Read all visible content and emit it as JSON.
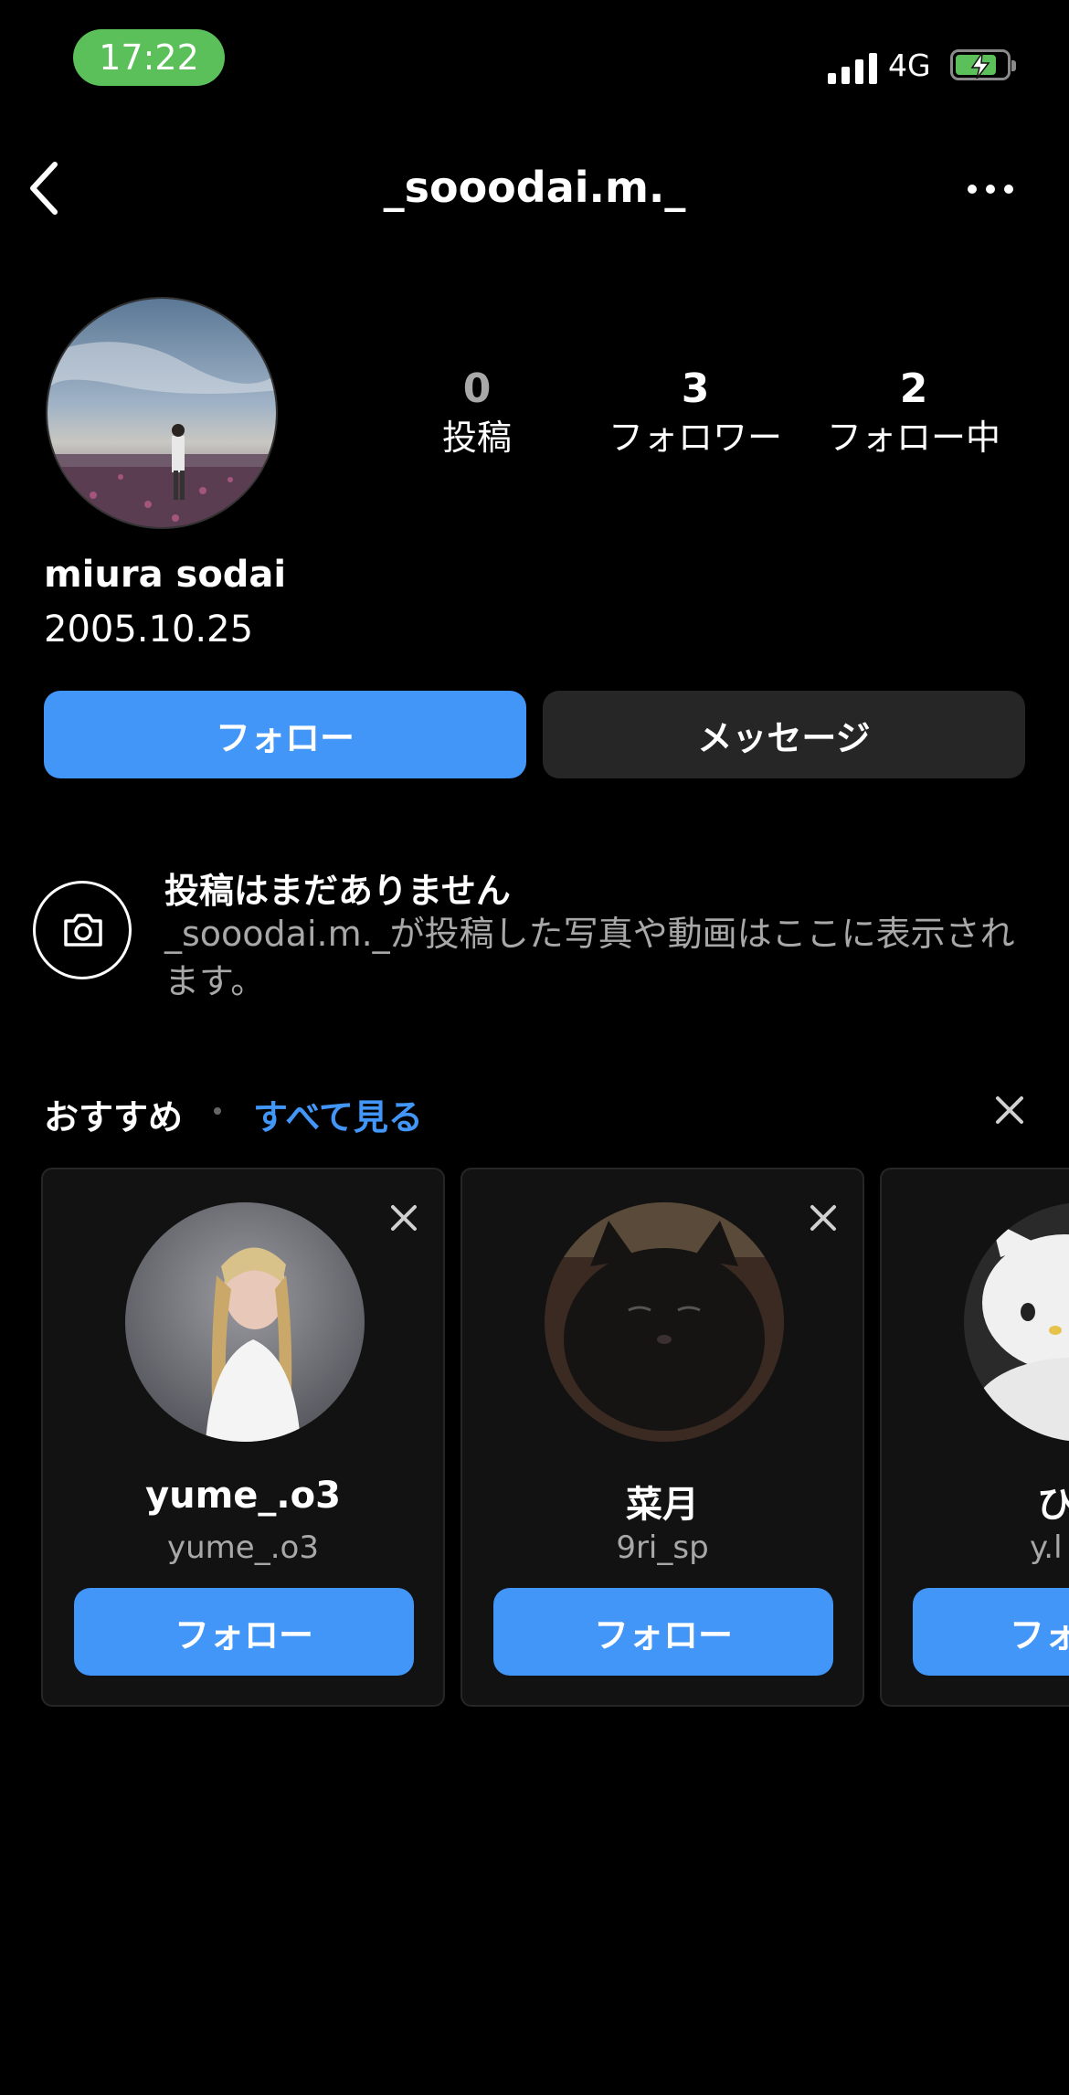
{
  "status_bar": {
    "time": "17:22",
    "network": "4G"
  },
  "header": {
    "username": "_sooodai.m._"
  },
  "profile": {
    "stats": [
      {
        "value": "0",
        "label": "投稿"
      },
      {
        "value": "3",
        "label": "フォロワー"
      },
      {
        "value": "2",
        "label": "フォロー中"
      }
    ],
    "name": "miura sodai",
    "bio": "2005.10.25"
  },
  "actions": {
    "follow": "フォロー",
    "message": "メッセージ"
  },
  "empty_state": {
    "title": "投稿はまだありません",
    "description": "_sooodai.m._が投稿した写真や動画はここに表示されます。"
  },
  "suggestions": {
    "label": "おすすめ",
    "see_all": "すべて見る",
    "cards": [
      {
        "name": "yume_.o3",
        "username": "yume_.o3",
        "button": "フォロー"
      },
      {
        "name": "菜月",
        "username": "9ri_sp",
        "button": "フォロー"
      },
      {
        "name": "ひ",
        "username": "y.l",
        "button": "フォ"
      }
    ]
  },
  "colors": {
    "accent": "#4196f7",
    "status_green": "#5cc05a",
    "secondary_button": "#262626"
  },
  "icons": [
    "back-chevron-icon",
    "more-dots-icon",
    "camera-icon",
    "close-icon",
    "signal-icon",
    "battery-charging-icon"
  ]
}
